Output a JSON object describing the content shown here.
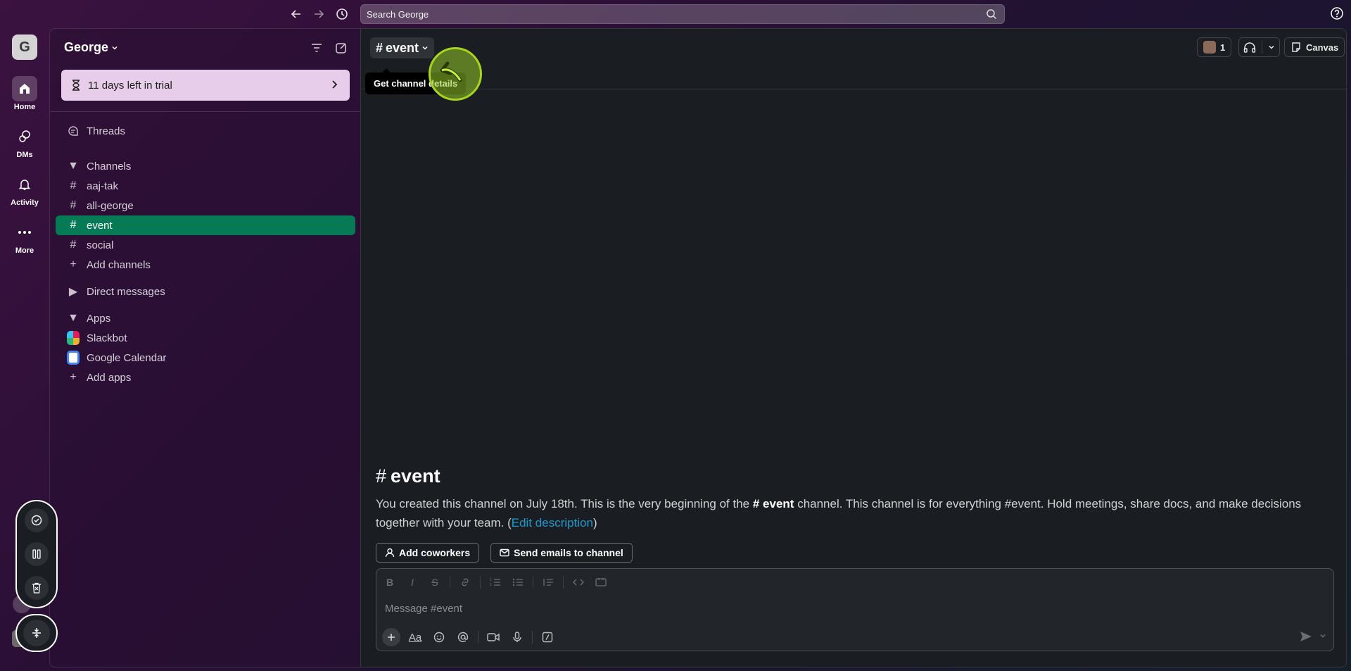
{
  "search": {
    "placeholder": "Search George"
  },
  "rail": {
    "workspace_initial": "G",
    "items": [
      {
        "label": "Home"
      },
      {
        "label": "DMs"
      },
      {
        "label": "Activity"
      },
      {
        "label": "More"
      }
    ]
  },
  "sidebar": {
    "workspace_name": "George",
    "trial_text": "11 days left in trial",
    "threads": "Threads",
    "channels_header": "Channels",
    "channels": [
      "aaj-tak",
      "all-george",
      "event",
      "social"
    ],
    "add_channels": "Add channels",
    "dm_header": "Direct messages",
    "apps_header": "Apps",
    "apps": [
      "Slackbot",
      "Google Calendar"
    ],
    "add_apps": "Add apps",
    "active_channel": "event"
  },
  "header": {
    "channel_name": "event",
    "tooltip": "Get channel details",
    "member_count": "1",
    "canvas_label": "Canvas"
  },
  "intro": {
    "title": "event",
    "text_before": "You created this channel on July 18th. This is the very beginning of the ",
    "channel_ref": "event",
    "text_after": " channel. This channel is for everything #event. Hold meetings, share docs, and make decisions together with your team. (",
    "edit_link": "Edit description",
    "text_close": ")",
    "add_coworkers": "Add coworkers",
    "send_emails": "Send emails to channel"
  },
  "composer": {
    "placeholder": "Message #event"
  },
  "colors": {
    "active_channel_bg": "#067a55",
    "trial_bg": "#e7cde9",
    "link": "#1d9bd1",
    "cursor_highlight": "#a6d41f"
  }
}
